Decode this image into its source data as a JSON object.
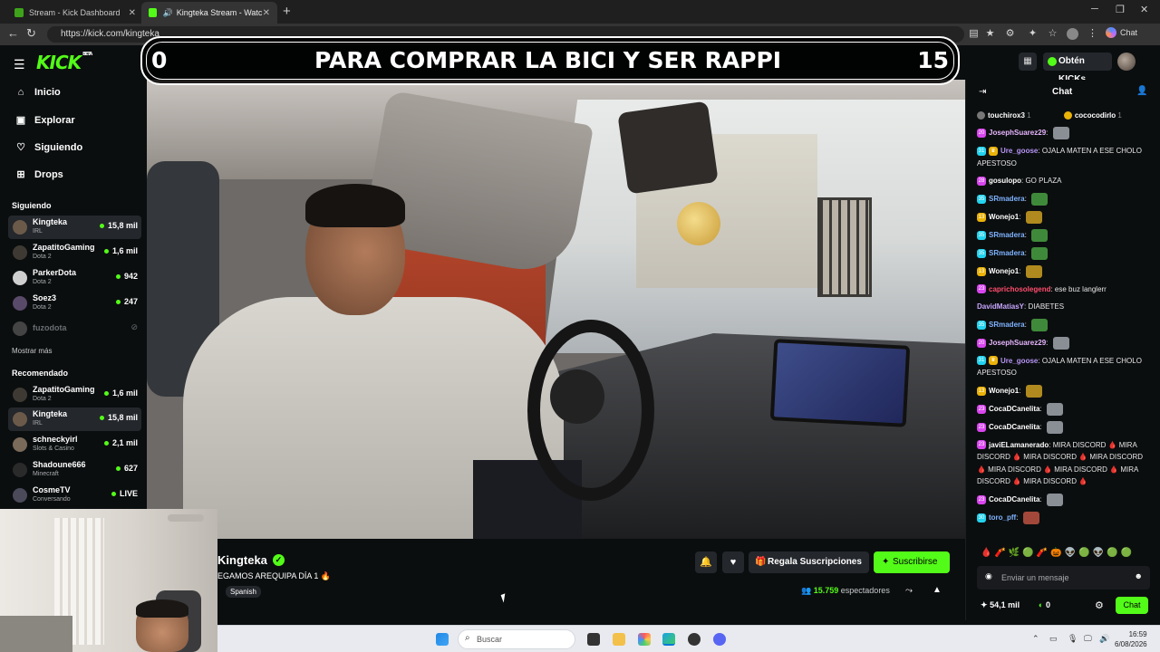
{
  "browser": {
    "tabs": [
      {
        "label": "Stream - Kick Dashboard"
      },
      {
        "label": "Kingteka Stream - Watch Live"
      }
    ],
    "url": "https://kick.com/kingteka",
    "chat_button": "Chat"
  },
  "header": {
    "logo": "KICK",
    "logo_tag": "BETA",
    "get_kicks": "Obtén KICKs"
  },
  "banner": {
    "left_count": "0",
    "title": "PARA COMPRAR LA BICI Y SER RAPPI",
    "right_count": "15"
  },
  "sidebar": {
    "nav": [
      {
        "label": "Inicio",
        "icon": "home-icon"
      },
      {
        "label": "Explorar",
        "icon": "compass-icon"
      },
      {
        "label": "Siguiendo",
        "icon": "heart-icon"
      },
      {
        "label": "Drops",
        "icon": "drops-icon"
      }
    ],
    "following_title": "Siguiendo",
    "following": [
      {
        "name": "Kingteka",
        "category": "IRL",
        "viewers": "15,8 mil",
        "selected": true
      },
      {
        "name": "ZapatitoGaming",
        "category": "Dota 2",
        "viewers": "1,6 mil"
      },
      {
        "name": "ParkerDota",
        "category": "Dota 2",
        "viewers": "942"
      },
      {
        "name": "Soez3",
        "category": "Dota 2",
        "viewers": "247"
      },
      {
        "name": "fuzodota",
        "category": "",
        "viewers": "",
        "offline": true
      }
    ],
    "show_more": "Mostrar más",
    "recommended_title": "Recomendado",
    "recommended": [
      {
        "name": "ZapatitoGaming",
        "category": "Dota 2",
        "viewers": "1,6 mil"
      },
      {
        "name": "Kingteka",
        "category": "IRL",
        "viewers": "15,8 mil",
        "selected": true
      },
      {
        "name": "schneckyirl",
        "category": "Slots & Casino",
        "viewers": "2,1 mil"
      },
      {
        "name": "Shadoune666",
        "category": "Minecraft",
        "viewers": "627"
      },
      {
        "name": "CosmeTV",
        "category": "Conversando",
        "viewers": "LIVE"
      }
    ]
  },
  "stream": {
    "streamer": "Kingteka",
    "title": "EGAMOS AREQUIPA DÍA 1 🔥",
    "language": "Spanish",
    "gift_label": "Regala Suscripciones",
    "subscribe_label": "Suscribirse",
    "viewers": "15.759",
    "viewers_label": "espectadores"
  },
  "chat": {
    "title": "Chat",
    "pinned": [
      {
        "user": "touchirox3",
        "count": "1"
      },
      {
        "user": "cococodirlo",
        "count": "1"
      }
    ],
    "messages": [
      {
        "badge": "20",
        "badge_color": "#d946ef",
        "user": "JosephSuarez29",
        "color": "#e7b6ff",
        "text": "",
        "emote": "#8a8f96"
      },
      {
        "badge": "31",
        "badge_color": "#22d3ee",
        "user": "Ure_goose",
        "color": "#b794f6",
        "text": "OJALA MATEN A ESE CHOLO APESTOSO",
        "crown": true
      },
      {
        "badge": "28",
        "badge_color": "#d946ef",
        "user": "gosulopo",
        "color": "#ffffff",
        "text": "GO PLAZA"
      },
      {
        "badge": "35",
        "badge_color": "#22d3ee",
        "user": "SRmadera",
        "color": "#7fb3ff",
        "text": "",
        "emote": "#3f8a3a"
      },
      {
        "badge": "13",
        "badge_color": "#eab308",
        "user": "Wonejo1",
        "color": "#ffffff",
        "text": "",
        "emote": "#b08a1e"
      },
      {
        "badge": "35",
        "badge_color": "#22d3ee",
        "user": "SRmadera",
        "color": "#7fb3ff",
        "text": "",
        "emote": "#3f8a3a"
      },
      {
        "badge": "35",
        "badge_color": "#22d3ee",
        "user": "SRmadera",
        "color": "#7fb3ff",
        "text": "",
        "emote": "#3f8a3a"
      },
      {
        "badge": "13",
        "badge_color": "#eab308",
        "user": "Wonejo1",
        "color": "#ffffff",
        "text": "",
        "emote": "#b08a1e"
      },
      {
        "badge": "23",
        "badge_color": "#d946ef",
        "user": "caprichosolegend",
        "color": "#ff4d6d",
        "text": "ese buz langlerr"
      },
      {
        "badge": "",
        "badge_color": "",
        "user": "DavidMatiasY",
        "color": "#c7a6ff",
        "text": "DIABETES"
      },
      {
        "badge": "35",
        "badge_color": "#22d3ee",
        "user": "SRmadera",
        "color": "#7fb3ff",
        "text": "",
        "emote": "#3f8a3a"
      },
      {
        "badge": "20",
        "badge_color": "#d946ef",
        "user": "JosephSuarez29",
        "color": "#e7b6ff",
        "text": "",
        "emote": "#8a8f96"
      },
      {
        "badge": "31",
        "badge_color": "#22d3ee",
        "user": "Ure_goose",
        "color": "#b794f6",
        "text": "OJALA MATEN A ESE CHOLO APESTOSO",
        "crown": true
      },
      {
        "badge": "13",
        "badge_color": "#eab308",
        "user": "Wonejo1",
        "color": "#ffffff",
        "text": "",
        "emote": "#b08a1e"
      },
      {
        "badge": "23",
        "badge_color": "#d946ef",
        "user": "CocaDCanelita",
        "color": "#ffffff",
        "text": "",
        "emote": "#8a8f96"
      },
      {
        "badge": "23",
        "badge_color": "#d946ef",
        "user": "CocaDCanelita",
        "color": "#ffffff",
        "text": "",
        "emote": "#8a8f96"
      },
      {
        "badge": "23",
        "badge_color": "#d946ef",
        "user": "javiELamanerado",
        "color": "#ffffff",
        "text": "MIRA DISCORD 🩸 MIRA DISCORD 🩸 MIRA DISCORD 🩸 MIRA DISCORD 🩸 MIRA DISCORD 🩸 MIRA DISCORD 🩸 MIRA DISCORD 🩸 MIRA DISCORD 🩸"
      },
      {
        "badge": "23",
        "badge_color": "#d946ef",
        "user": "CocaDCanelita",
        "color": "#ffffff",
        "text": "",
        "emote": "#8a8f96"
      },
      {
        "badge": "30",
        "badge_color": "#22d3ee",
        "user": "toro_pff",
        "color": "#7fb3ff",
        "text": "",
        "emote": "#a2483a"
      }
    ],
    "emote_bar": "🩸🧨🌿🟢🧨🎃👽🟢👽🟢🟢",
    "input_placeholder": "Enviar un mensaje",
    "kicks_count": "54,1 mil",
    "zero_count": "0",
    "chat_label": "Chat"
  },
  "taskbar": {
    "search_placeholder": "Buscar",
    "time": "16:59",
    "date": "6/08/2026"
  }
}
